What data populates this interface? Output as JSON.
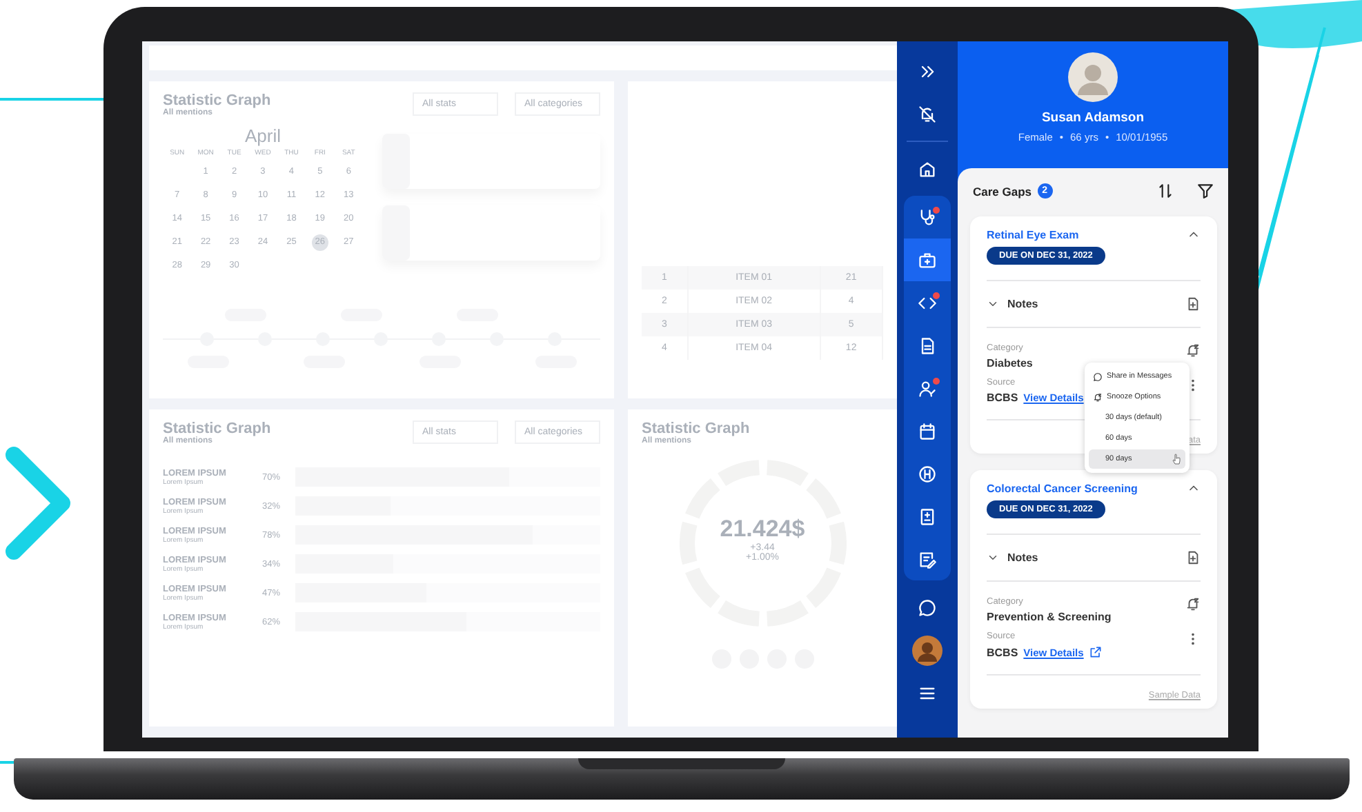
{
  "dashboard": {
    "calendar_card": {
      "title": "Statistic Graph",
      "subtitle": "All mentions",
      "filters": [
        "All stats",
        "All categories"
      ],
      "month": "April",
      "weekdays": [
        "SUN",
        "MON",
        "TUE",
        "WED",
        "THU",
        "FRI",
        "SAT"
      ],
      "weeks": [
        [
          {
            "day": "1",
            "selected": false
          },
          {
            "day": "2",
            "selected": false
          },
          {
            "day": "3",
            "selected": false
          },
          {
            "day": "4",
            "selected": false
          },
          {
            "day": "5",
            "selected": false
          },
          {
            "day": "6",
            "selected": false
          }
        ],
        [
          {
            "day": "7",
            "selected": false
          },
          {
            "day": "8",
            "selected": false
          },
          {
            "day": "9",
            "selected": false
          },
          {
            "day": "10",
            "selected": false
          },
          {
            "day": "11",
            "selected": false
          },
          {
            "day": "12",
            "selected": false
          },
          {
            "day": "13",
            "selected": false
          }
        ],
        [
          {
            "day": "14",
            "selected": false
          },
          {
            "day": "15",
            "selected": false
          },
          {
            "day": "16",
            "selected": false
          },
          {
            "day": "17",
            "selected": false
          },
          {
            "day": "18",
            "selected": false
          },
          {
            "day": "19",
            "selected": false
          },
          {
            "day": "20",
            "selected": false
          }
        ],
        [
          {
            "day": "21",
            "selected": false
          },
          {
            "day": "22",
            "selected": false
          },
          {
            "day": "23",
            "selected": false
          },
          {
            "day": "24",
            "selected": false
          },
          {
            "day": "25",
            "selected": false
          },
          {
            "day": "26",
            "selected": true
          },
          {
            "day": "27",
            "selected": false
          }
        ],
        [
          {
            "day": "28",
            "selected": false
          },
          {
            "day": "29",
            "selected": false
          },
          {
            "day": "30",
            "selected": false
          }
        ]
      ]
    },
    "table_card": {
      "rows": [
        [
          "1",
          "ITEM 01",
          "21"
        ],
        [
          "2",
          "ITEM 02",
          "4"
        ],
        [
          "3",
          "ITEM 03",
          "5"
        ],
        [
          "4",
          "ITEM 04",
          "12"
        ]
      ]
    },
    "bars_card": {
      "title": "Statistic Graph",
      "subtitle": "All mentions",
      "filters": [
        "All stats",
        "All categories"
      ],
      "rows": [
        {
          "label": "LOREM IPSUM",
          "sublabel": "Lorem Ipsum",
          "reading": "70%",
          "level": 0.7
        },
        {
          "label": "LOREM IPSUM",
          "sublabel": "Lorem Ipsum",
          "reading": "32%",
          "level": 0.31
        },
        {
          "label": "LOREM IPSUM",
          "sublabel": "Lorem Ipsum",
          "reading": "78%",
          "level": 0.78
        },
        {
          "label": "LOREM IPSUM",
          "sublabel": "Lorem Ipsum",
          "reading": "34%",
          "level": 0.32
        },
        {
          "label": "LOREM IPSUM",
          "sublabel": "Lorem Ipsum",
          "reading": "47%",
          "level": 0.43
        },
        {
          "label": "LOREM IPSUM",
          "sublabel": "Lorem Ipsum",
          "reading": "62%",
          "level": 0.56
        }
      ]
    },
    "donut_card": {
      "title": "Statistic Graph",
      "subtitle": "All mentions",
      "value": "21.424$",
      "changes": [
        "+3.44",
        "+1.00%"
      ]
    }
  },
  "rail": {
    "items": [
      {
        "kind": "expand",
        "grouped": false,
        "selected": false,
        "badge": false
      },
      {
        "kind": "bell-off",
        "grouped": false,
        "selected": false,
        "badge": false
      },
      {
        "kind": "home",
        "grouped": false,
        "selected": false,
        "badge": false
      },
      {
        "kind": "stethoscope",
        "grouped": true,
        "selected": false,
        "badge": true
      },
      {
        "kind": "medkit",
        "grouped": true,
        "selected": true,
        "badge": false
      },
      {
        "kind": "code",
        "grouped": true,
        "selected": false,
        "badge": true
      },
      {
        "kind": "document",
        "grouped": true,
        "selected": false,
        "badge": false
      },
      {
        "kind": "people",
        "grouped": true,
        "selected": false,
        "badge": true
      },
      {
        "kind": "calendar",
        "grouped": true,
        "selected": false,
        "badge": false
      },
      {
        "kind": "hospital",
        "grouped": true,
        "selected": false,
        "badge": false
      },
      {
        "kind": "report",
        "grouped": true,
        "selected": false,
        "badge": false
      },
      {
        "kind": "notes",
        "grouped": true,
        "selected": false,
        "badge": false
      },
      {
        "kind": "chat",
        "grouped": false,
        "selected": false,
        "badge": false
      },
      {
        "kind": "avatar",
        "grouped": false,
        "selected": false,
        "badge": false
      },
      {
        "kind": "menu",
        "grouped": false,
        "selected": false,
        "badge": false
      }
    ]
  },
  "patient": {
    "name": "Susan Adamson",
    "details": [
      "Female",
      "•",
      "66 yrs",
      "•",
      "10/01/1955"
    ]
  },
  "care_gaps": {
    "title": "Care Gaps",
    "count": "2",
    "gaps": [
      {
        "title": "Retinal Eye Exam",
        "due": "DUE ON DEC 31, 2022",
        "expanded": true,
        "notes": "Notes",
        "category_label": "Category",
        "category": "Diabetes",
        "source_label": "Source",
        "source": "BCBS",
        "link": "View Details",
        "external_link_icon": false,
        "footer": "ata",
        "menu_open": true
      },
      {
        "title": "Colorectal Cancer Screening",
        "due": "DUE ON DEC 31, 2022",
        "expanded": true,
        "notes": "Notes",
        "category_label": "Category",
        "category": "Prevention & Screening",
        "source_label": "Source",
        "source": "BCBS",
        "link": "View Details",
        "external_link_icon": true,
        "footer": "Sample Data",
        "menu_open": false
      }
    ]
  },
  "menu": {
    "items": [
      {
        "kind": "share",
        "label": "Share in Messages",
        "selected": false
      },
      {
        "kind": "snooze",
        "label": "Snooze Options",
        "selected": false
      },
      {
        "kind": "option",
        "label": "30 days (default)",
        "selected": false
      },
      {
        "kind": "option",
        "label": "60 days",
        "selected": false
      },
      {
        "kind": "option",
        "label": "90 days",
        "selected": true
      }
    ]
  }
}
